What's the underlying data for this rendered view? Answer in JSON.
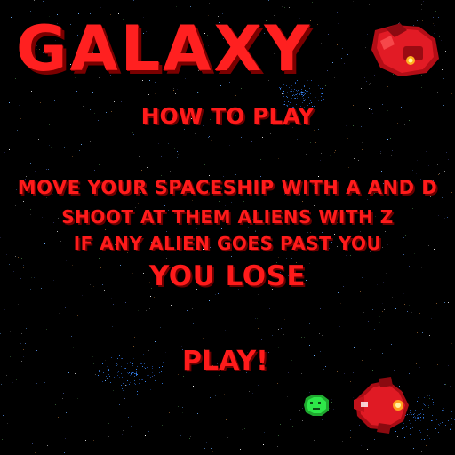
{
  "game": {
    "title": "GALAXY",
    "subtitle": "HOW TO PLAY",
    "instructions": {
      "line1": "MOVE YOUR SPACESHIP WITH A AND D",
      "line2": "SHOOT AT THEM ALIENS WITH Z",
      "line3": "IF ANY ALIEN GOES PAST YOU",
      "line4": "YOU LOSE"
    },
    "play_label": "PLAY!"
  },
  "colors": {
    "text": "#ff1b1b",
    "text_shadow": "#6a0000",
    "background": "#000000",
    "ship_body": "#d8141e",
    "alien": "#22e03a"
  },
  "icons": {
    "title_ship": "player-spaceship-icon",
    "player_ship": "player-spaceship-icon",
    "enemy": "green-alien-icon"
  }
}
